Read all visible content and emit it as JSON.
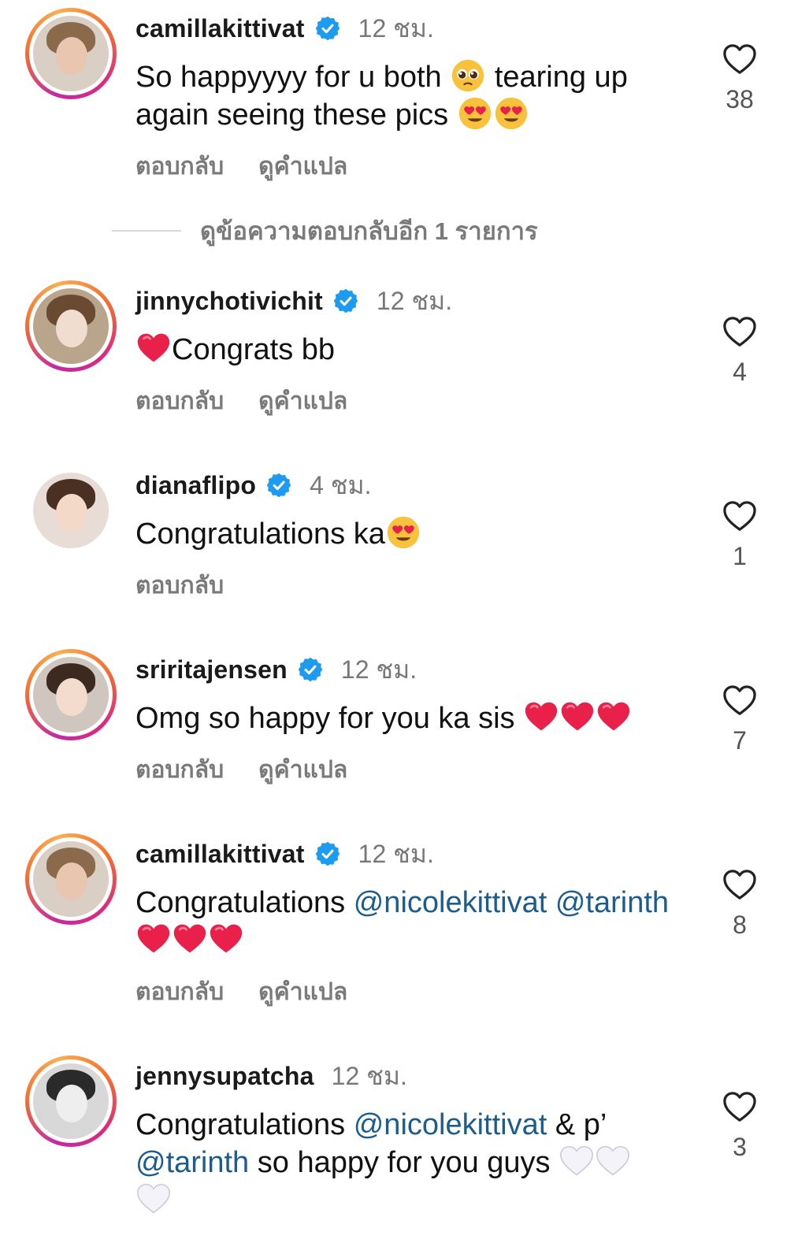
{
  "colors": {
    "mention": "#1d5c8e",
    "verified": "#1d9bf0",
    "muted": "#7a7a7a",
    "heart_red": "#e8204a"
  },
  "comments": [
    {
      "username": "camillakittivat",
      "verified": true,
      "time": "12 ชม.",
      "text_parts": [
        "So happyyyy for u both ",
        "tearing up again seeing these pics "
      ],
      "reply_label": "ตอบกลับ",
      "translate_label": "ดูคำแปล",
      "like_count": "38"
    },
    {
      "username": "jinnychotivichit",
      "verified": true,
      "time": "12 ชม.",
      "text": "Congrats bb",
      "reply_label": "ตอบกลับ",
      "translate_label": "ดูคำแปล",
      "like_count": "4"
    },
    {
      "username": "dianaflipo",
      "verified": true,
      "time": "4 ชม.",
      "text": "Congratulations ka",
      "reply_label": "ตอบกลับ",
      "like_count": "1"
    },
    {
      "username": "sriritajensen",
      "verified": true,
      "time": "12 ชม.",
      "text": "Omg so happy for you ka sis ",
      "reply_label": "ตอบกลับ",
      "translate_label": "ดูคำแปล",
      "like_count": "7"
    },
    {
      "username": "camillakittivat",
      "verified": true,
      "time": "12 ชม.",
      "text_prefix": "Congratulations ",
      "mention_1": "@nicolekittivat",
      "mention_2": "@tarinth",
      "reply_label": "ตอบกลับ",
      "translate_label": "ดูคำแปล",
      "like_count": "8"
    },
    {
      "username": "jennysupatcha",
      "verified": false,
      "time": "12 ชม.",
      "text_prefix": "Congratulations ",
      "mention_1": "@nicolekittivat",
      "text_mid": " & p’",
      "mention_2": "@tarinth",
      "text_suffix": " so happy for you guys ",
      "like_count": "3"
    }
  ],
  "view_replies": "ดูข้อความตอบกลับอีก 1 รายการ"
}
